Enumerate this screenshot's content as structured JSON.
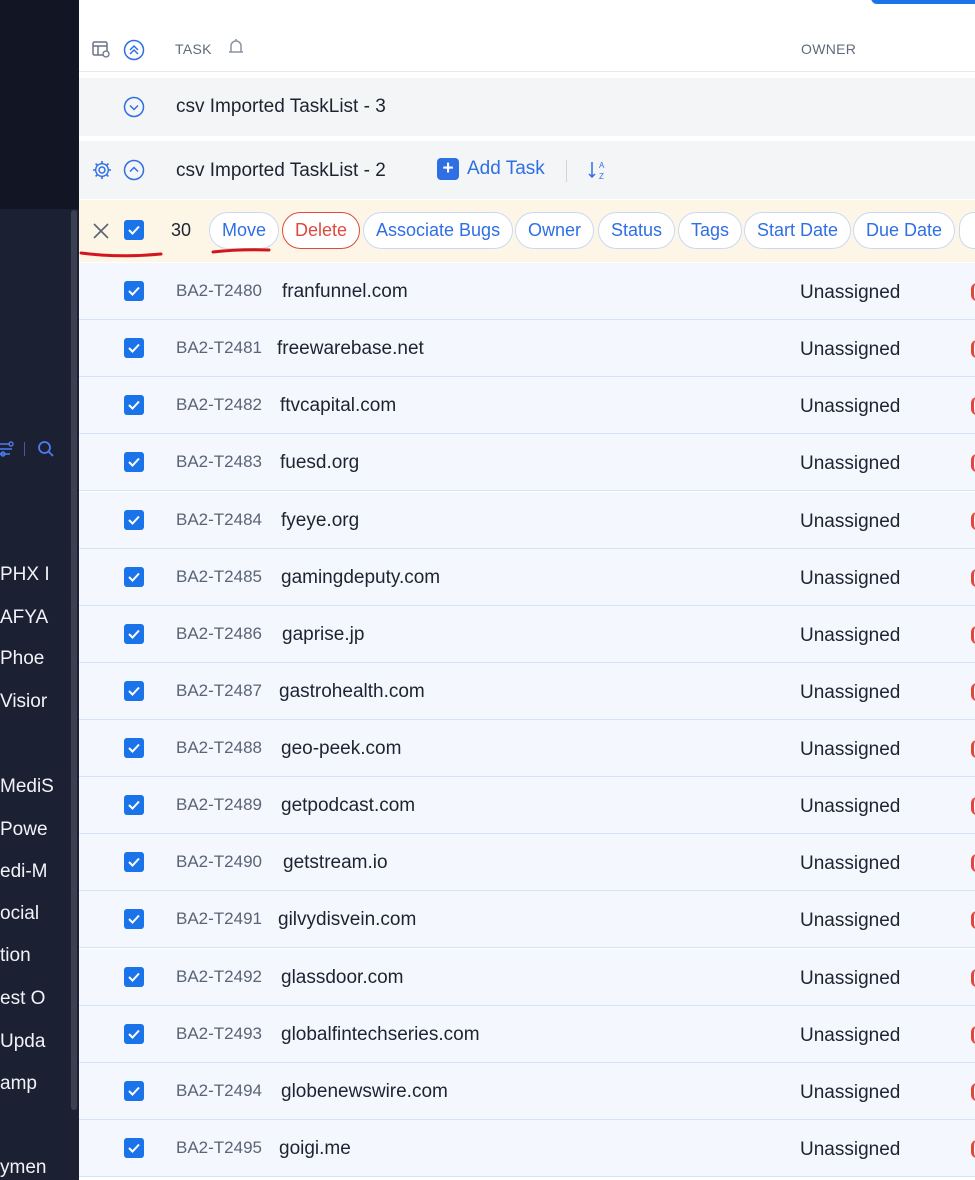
{
  "header": {
    "task_label": "TASK",
    "owner_label": "OWNER"
  },
  "tasklists": [
    {
      "title": "csv Imported TaskList - 3"
    },
    {
      "title": "csv Imported TaskList - 2",
      "add_task_label": "Add Task"
    }
  ],
  "selection": {
    "count": "30",
    "actions": [
      "Move",
      "Delete",
      "Associate Bugs",
      "Owner",
      "Status",
      "Tags",
      "Start Date",
      "Due Date"
    ]
  },
  "tasks": [
    {
      "id": "BA2-T2480",
      "name": "franfunnel.com",
      "owner": "Unassigned"
    },
    {
      "id": "BA2-T2481",
      "name": "freewarebase.net",
      "owner": "Unassigned"
    },
    {
      "id": "BA2-T2482",
      "name": "ftvcapital.com",
      "owner": "Unassigned"
    },
    {
      "id": "BA2-T2483",
      "name": "fuesd.org",
      "owner": "Unassigned"
    },
    {
      "id": "BA2-T2484",
      "name": "fyeye.org",
      "owner": "Unassigned"
    },
    {
      "id": "BA2-T2485",
      "name": "gamingdeputy.com",
      "owner": "Unassigned"
    },
    {
      "id": "BA2-T2486",
      "name": "gaprise.jp",
      "owner": "Unassigned"
    },
    {
      "id": "BA2-T2487",
      "name": "gastrohealth.com",
      "owner": "Unassigned"
    },
    {
      "id": "BA2-T2488",
      "name": "geo-peek.com",
      "owner": "Unassigned"
    },
    {
      "id": "BA2-T2489",
      "name": "getpodcast.com",
      "owner": "Unassigned"
    },
    {
      "id": "BA2-T2490",
      "name": "getstream.io",
      "owner": "Unassigned"
    },
    {
      "id": "BA2-T2491",
      "name": "gilvydisvein.com",
      "owner": "Unassigned"
    },
    {
      "id": "BA2-T2492",
      "name": "glassdoor.com",
      "owner": "Unassigned"
    },
    {
      "id": "BA2-T2493",
      "name": "globalfintechseries.com",
      "owner": "Unassigned"
    },
    {
      "id": "BA2-T2494",
      "name": "globenewswire.com",
      "owner": "Unassigned"
    },
    {
      "id": "BA2-T2495",
      "name": "goigi.me",
      "owner": "Unassigned"
    }
  ],
  "sidebar": {
    "items": [
      "PHX I",
      "AFYA",
      "Phoe",
      "Visior",
      "MediS",
      "Powe",
      "edi-M",
      "ocial",
      "tion",
      "est O",
      "Upda",
      "amp",
      "ymen"
    ]
  },
  "colors": {
    "accent": "#1a73e8",
    "danger": "#e0483f",
    "sidebar_bg": "#1c2033",
    "action_bar_bg": "#fdf6e6",
    "row_bg": "#f4f7fd"
  }
}
